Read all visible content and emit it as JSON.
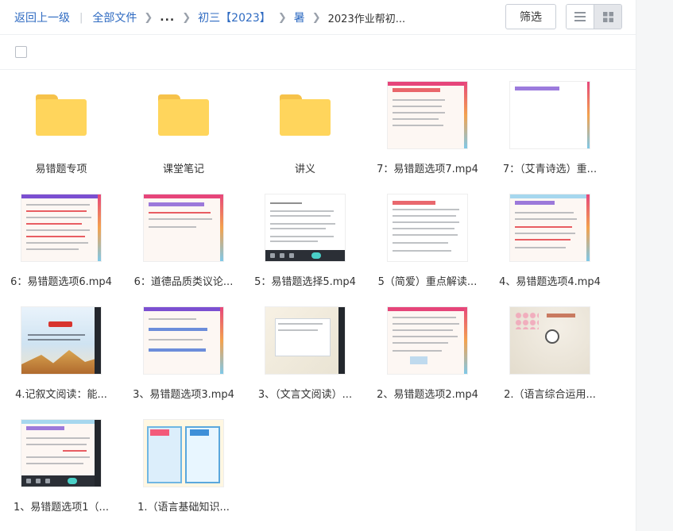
{
  "breadcrumb": {
    "back": "返回上一级",
    "all_files": "全部文件",
    "ellipsis": "...",
    "level1": "初三【2023】",
    "level2": "暑",
    "current": "2023作业帮初..."
  },
  "toolbar": {
    "filter_label": "筛选"
  },
  "view_modes": [
    {
      "icon": "list-icon",
      "active": false
    },
    {
      "icon": "grid-icon",
      "active": true
    }
  ],
  "items": [
    {
      "type": "folder",
      "label": "易错题专项"
    },
    {
      "type": "folder",
      "label": "课堂笔记"
    },
    {
      "type": "folder",
      "label": "讲义"
    },
    {
      "type": "video",
      "label": "7：易错题选项7.mp4"
    },
    {
      "type": "video",
      "label": "7：（艾青诗选）重..."
    },
    {
      "type": "video",
      "label": "6：易错题选项6.mp4"
    },
    {
      "type": "video",
      "label": "6：道德品质类议论..."
    },
    {
      "type": "video",
      "label": "5：易错题选择5.mp4"
    },
    {
      "type": "video",
      "label": "5（简爱）重点解读..."
    },
    {
      "type": "video",
      "label": "4、易错题选项4.mp4"
    },
    {
      "type": "video",
      "label": "4.记叙文阅读：能..."
    },
    {
      "type": "video",
      "label": "3、易错题选项3.mp4"
    },
    {
      "type": "video",
      "label": "3、（文言文阅读）..."
    },
    {
      "type": "video",
      "label": "2、易错题选项2.mp4"
    },
    {
      "type": "video",
      "label": "2.（语言综合运用..."
    },
    {
      "type": "video",
      "label": "1、易错题选项1（..."
    },
    {
      "type": "video",
      "label": "1.（语言基础知识..."
    }
  ]
}
